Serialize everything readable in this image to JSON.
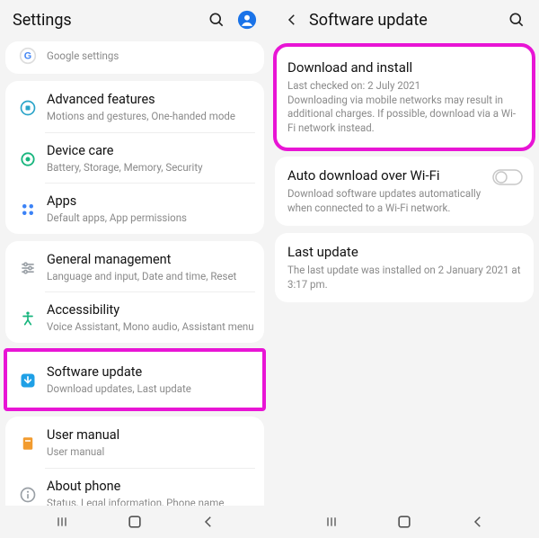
{
  "left": {
    "header_title": "Settings",
    "items": [
      {
        "title": "",
        "sub": "Google settings"
      },
      {
        "title": "Advanced features",
        "sub": "Motions and gestures, One-handed mode"
      },
      {
        "title": "Device care",
        "sub": "Battery, Storage, Memory, Security"
      },
      {
        "title": "Apps",
        "sub": "Default apps, App permissions"
      },
      {
        "title": "General management",
        "sub": "Language and input, Date and time, Reset"
      },
      {
        "title": "Accessibility",
        "sub": "Voice Assistant, Mono audio, Assistant menu"
      },
      {
        "title": "Software update",
        "sub": "Download updates, Last update"
      },
      {
        "title": "User manual",
        "sub": "User manual"
      },
      {
        "title": "About phone",
        "sub": "Status, Legal information, Phone name"
      }
    ]
  },
  "right": {
    "header_title": "Software update",
    "cards": [
      {
        "title": "Download and install",
        "sub": "Last checked on: 2 July 2021\nDownloading via mobile networks may result in additional charges. If possible, download via a Wi-Fi network instead."
      },
      {
        "title": "Auto download over Wi-Fi",
        "sub": "Download software updates automatically when connected to a Wi-Fi network."
      },
      {
        "title": "Last update",
        "sub": "The last update was installed on 2 January 2021 at 3:17 pm."
      }
    ]
  }
}
